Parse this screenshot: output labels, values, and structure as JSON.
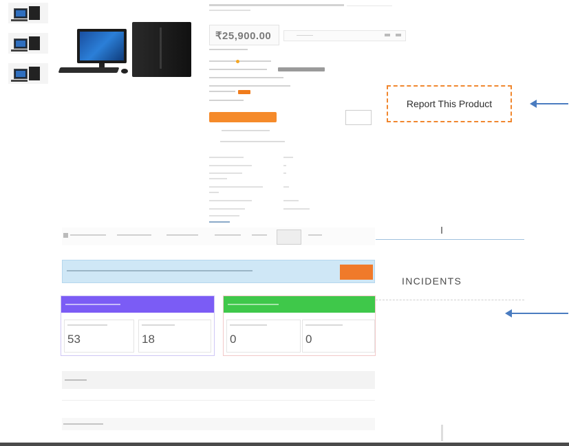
{
  "product": {
    "title": "",
    "price": "₹25,900.00"
  },
  "callouts": {
    "report_label": "Report This Product",
    "incidents_label": "INCIDENTS"
  },
  "nav": {
    "items": [
      "",
      "",
      "",
      "",
      "",
      "",
      ""
    ]
  },
  "banner": {
    "text": "",
    "button": ""
  },
  "cards": {
    "left": {
      "header": "",
      "header_color": "#7b5cf5",
      "cells": [
        {
          "label": "",
          "value": "53"
        },
        {
          "label": "",
          "value": "18"
        }
      ]
    },
    "right": {
      "header": "",
      "header_color": "#3fc84a",
      "cells": [
        {
          "label": "",
          "value": "0"
        },
        {
          "label": "",
          "value": "0"
        }
      ]
    }
  },
  "sections": {
    "first": "",
    "second": ""
  },
  "colors": {
    "accent_orange": "#f58a2a",
    "arrow_blue": "#4a7cc0"
  },
  "icons": {
    "arrow_report": "arrow-left-icon",
    "arrow_incidents": "arrow-left-icon",
    "home": "home-icon"
  }
}
